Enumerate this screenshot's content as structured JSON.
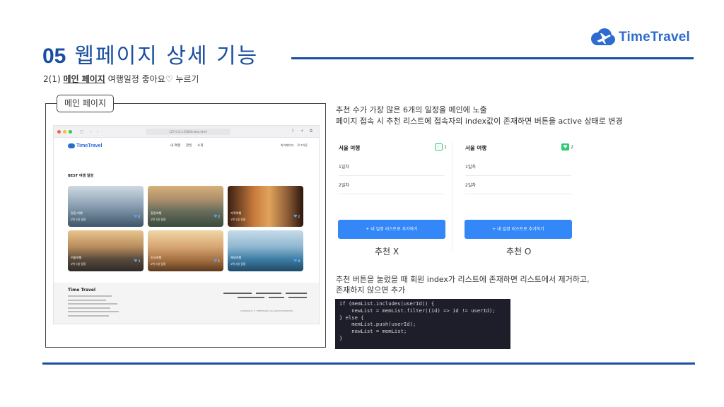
{
  "header": {
    "number": "05",
    "title": "웹페이지 상세 기능",
    "subtitle_prefix": "2(1) ",
    "subtitle_bold": "메인 페이지",
    "subtitle_rest": " 여행일정 좋아요♡ 누르기"
  },
  "logo": {
    "text": "TimeTravel"
  },
  "frame_label": "메인 페이지",
  "mockup": {
    "url": "127.0.0.1:5500/index.html",
    "site_logo": "TimeTravel",
    "menu": [
      "내 여행",
      "핫딜",
      "소개"
    ],
    "user": [
      "마이페이지",
      "로그아웃"
    ],
    "best_title": "BEST 여행 일정",
    "cards": [
      {
        "title": "맛집 여행",
        "period": "2박 3일 일정",
        "likes": "2"
      },
      {
        "title": "힐링여행",
        "period": "2박 3일 일정",
        "likes": "2"
      },
      {
        "title": "가족여행",
        "period": "1박 2일 일정",
        "likes": "2"
      },
      {
        "title": "겨울여행",
        "period": "2박 3일 일정",
        "likes": "3"
      },
      {
        "title": "전국여행",
        "period": "2박 3일 일정",
        "likes": "1"
      },
      {
        "title": "해외여행",
        "period": "2박 3일 일정",
        "likes": "4"
      }
    ],
    "footer_title": "Time Travel",
    "footer_copy": "COPYRIGHT © TIMETRAVEL ALL RIGHT RESERVED."
  },
  "desc1": [
    "추천 수가 가장 많은 6개의 일정을 메인에 노출",
    "페이지 접속 시 추천 리스트에 접속자의 index값이 존재하면 버튼을 active 상태로 변경"
  ],
  "panels": [
    {
      "title": "서울 여행",
      "count": "1",
      "day1": "1일차",
      "day2": "2일차",
      "button": "+ 내 일정 리스트로 추가하기",
      "caption": "추천 X",
      "active": false
    },
    {
      "title": "서울 여행",
      "count": "2",
      "day1": "1일차",
      "day2": "2일차",
      "button": "+ 내 일정 리스트로 추가하기",
      "caption": "추천 O",
      "active": true
    }
  ],
  "desc2": [
    "추천 버튼을 눌렀을 때 회원 index가 리스트에 존재하면 리스트에서 제거하고,",
    "존재하지 않으면 추가"
  ],
  "code_lines": [
    "if (memList.includes(userId)) {",
    "    newList = memList.filter((id) => id != userId);",
    "} else {",
    "    memList.push(userId);",
    "    newList = memList;",
    "}"
  ],
  "colors": {
    "brand_blue": "#1a4fa0",
    "logo_blue": "#2e6bd0",
    "button_blue": "#3387f7",
    "active_green": "#2ecc71"
  }
}
